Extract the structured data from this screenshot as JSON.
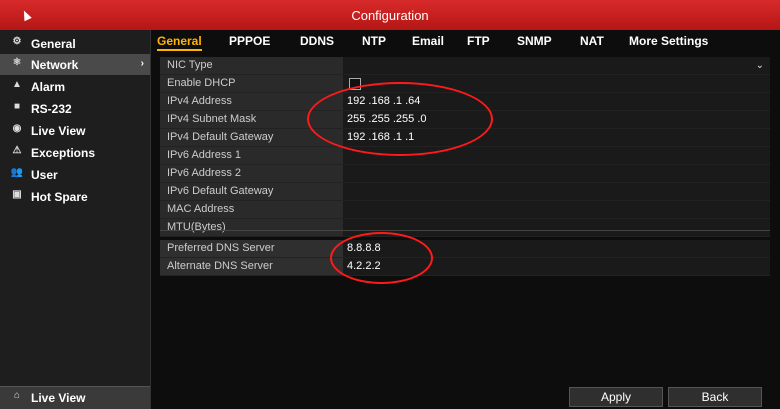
{
  "window": {
    "title": "Configuration"
  },
  "sidebar": {
    "items": [
      {
        "label": "General",
        "icon": "gear-icon"
      },
      {
        "label": "Network",
        "icon": "network-icon"
      },
      {
        "label": "Alarm",
        "icon": "bell-icon"
      },
      {
        "label": "RS-232",
        "icon": "serial-icon"
      },
      {
        "label": "Live View",
        "icon": "eye-icon"
      },
      {
        "label": "Exceptions",
        "icon": "warning-icon"
      },
      {
        "label": "User",
        "icon": "users-icon"
      },
      {
        "label": "Hot Spare",
        "icon": "server-icon"
      }
    ],
    "bottom": {
      "label": "Live View",
      "icon": "home-icon"
    }
  },
  "tabs": [
    "General",
    "PPPOE",
    "DDNS",
    "NTP",
    "Email",
    "FTP",
    "SNMP",
    "NAT",
    "More Settings"
  ],
  "form": {
    "rows": [
      {
        "label": "NIC Type",
        "value": ""
      },
      {
        "label": "Enable DHCP",
        "value": ""
      },
      {
        "label": "IPv4 Address",
        "value": "192 .168 .1     .64"
      },
      {
        "label": "IPv4 Subnet Mask",
        "value": "255 .255 .255 .0"
      },
      {
        "label": "IPv4 Default Gateway",
        "value": "192 .168 .1     .1"
      },
      {
        "label": "IPv6 Address 1",
        "value": ""
      },
      {
        "label": "IPv6 Address 2",
        "value": ""
      },
      {
        "label": "IPv6 Default Gateway",
        "value": ""
      },
      {
        "label": "MAC Address",
        "value": ""
      },
      {
        "label": "MTU(Bytes)",
        "value": ""
      }
    ],
    "dns": [
      {
        "label": "Preferred DNS Server",
        "value": "8.8.8.8"
      },
      {
        "label": "Alternate DNS Server",
        "value": "4.2.2.2"
      }
    ]
  },
  "buttons": {
    "apply": "Apply",
    "back": "Back"
  },
  "colors": {
    "accent": "#ffb400",
    "title_bar": "#c61f1f",
    "annotation": "#ff1a1a"
  }
}
